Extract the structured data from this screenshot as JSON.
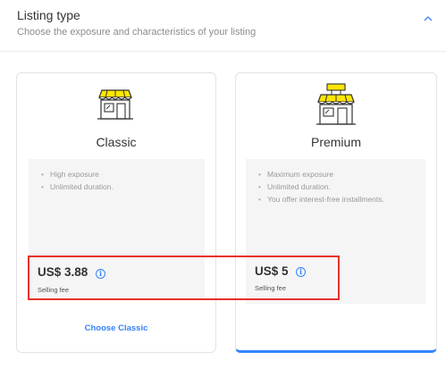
{
  "section": {
    "title": "Listing type",
    "subtitle": "Choose the exposure and characteristics of your listing",
    "collapse_icon": "chevron-up-icon"
  },
  "cards": {
    "classic": {
      "name": "Classic",
      "icon": "storefront-icon",
      "features": [
        "High exposure",
        "Unlimited duration."
      ],
      "price": "US$ 3.88",
      "fee_label": "Selling fee",
      "action": "Choose Classic"
    },
    "premium": {
      "name": "Premium",
      "icon": "storefront-with-sign-icon",
      "features": [
        "Maximum exposure",
        "Unlimited duration.",
        "You offer interest-free installments."
      ],
      "price": "US$ 5",
      "fee_label": "Selling fee",
      "selected": true
    }
  },
  "colors": {
    "accent": "#3483fa",
    "awning": "#ffe600",
    "highlight_box": "#e8312c"
  }
}
